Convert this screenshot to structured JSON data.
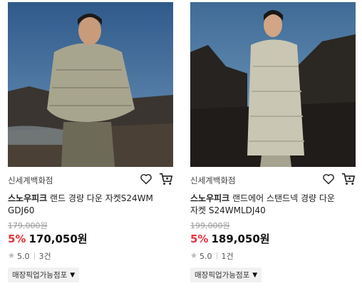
{
  "products": [
    {
      "store": "신세계백화점",
      "brand": "스노우피크",
      "title_rest_line1": " 랜드 경량 다운 자켓S24WM",
      "title_line2": "GDJ60",
      "original_price": "179,000원",
      "discount": "5%",
      "price": "170,050원",
      "rating": "5.0",
      "review_count": "3건",
      "pickup_label": "매장픽업가능점포"
    },
    {
      "store": "신세계백화점",
      "brand": "스노우피크",
      "title_rest_line1": " 랜드에어 스탠드넥 경량 다운",
      "title_line2": "자켓 S24WMLDJ40",
      "original_price": "199,000원",
      "discount": "5%",
      "price": "189,050원",
      "rating": "5.0",
      "review_count": "1건",
      "pickup_label": "매장픽업가능점포"
    }
  ],
  "icons": {
    "wishlist": "heart-outline-icon",
    "cart": "shopping-cart-icon",
    "star": "star-icon",
    "dropdown": "triangle-down-icon"
  },
  "colors": {
    "discount": "#e8323c",
    "strike": "#999999",
    "chip_bg": "#f1f1f1"
  }
}
